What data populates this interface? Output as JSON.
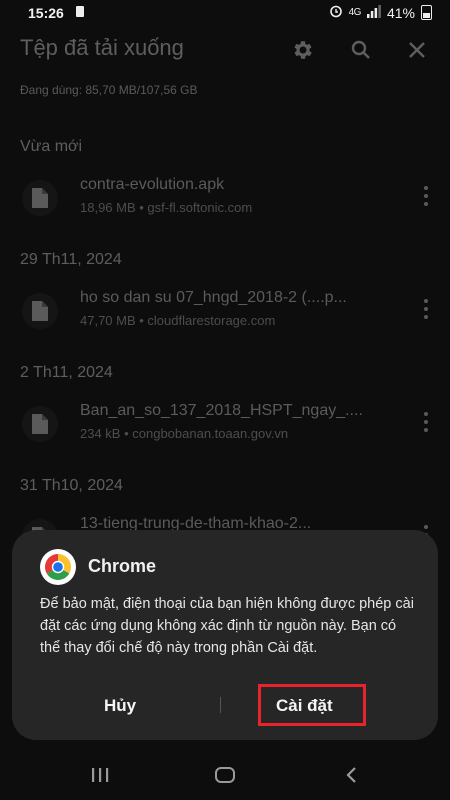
{
  "status_bar": {
    "time": "15:26",
    "battery": "41%",
    "icons": [
      "sd-card-icon",
      "alarm-icon",
      "4g-signal-icon",
      "signal-icon",
      "battery-icon"
    ]
  },
  "header": {
    "title": "Tệp đã tải xuống",
    "storage": "Đang dùng: 85,70 MB/107,56 GB",
    "icons": [
      "settings-icon",
      "search-icon",
      "close-icon"
    ]
  },
  "sections": [
    {
      "label": "Vừa mới",
      "files": [
        {
          "name": "contra-evolution.apk",
          "meta": "18,96 MB • gsf-fl.softonic.com"
        }
      ]
    },
    {
      "label": "29 Th11, 2024",
      "files": [
        {
          "name": "ho so dan su 07_hngd_2018-2 (....p...",
          "meta": "47,70 MB • cloudflarestorage.com"
        }
      ]
    },
    {
      "label": "2 Th11, 2024",
      "files": [
        {
          "name": "Ban_an_so_137_2018_HSPT_ngay_....",
          "meta": "234 kB • congbobanan.toaan.gov.vn"
        }
      ]
    },
    {
      "label": "31 Th10, 2024",
      "files": [
        {
          "name": "13-tieng-trung-de-tham-khao-2..."
        }
      ]
    }
  ],
  "dialog": {
    "app_name": "Chrome",
    "message": "Để bảo mật, điện thoại của bạn hiện không được phép cài đặt các ứng dụng không xác định từ nguồn này. Bạn có thể thay đổi chế độ này trong phần Cài đặt.",
    "cancel_label": "Hủy",
    "settings_label": "Cài đặt",
    "highlight_color": "#e8232b"
  },
  "nav_bar": {
    "icons": [
      "recents-icon",
      "home-icon",
      "back-icon"
    ]
  }
}
